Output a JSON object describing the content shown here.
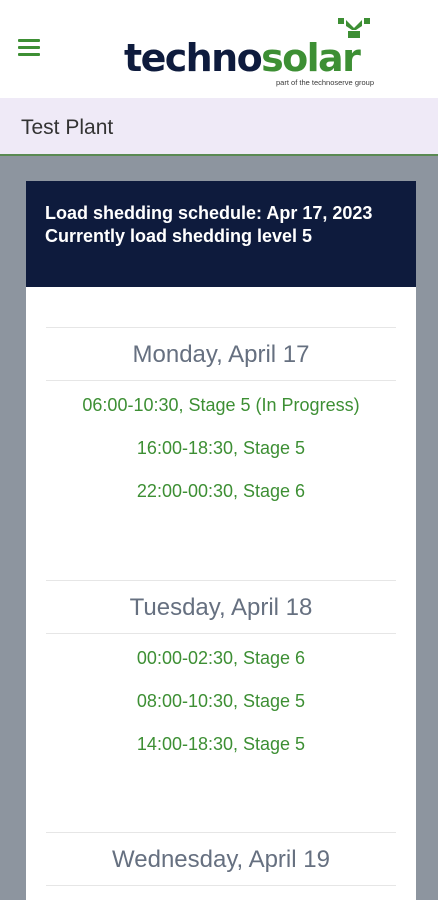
{
  "header": {
    "brand_part1": "techno",
    "brand_part2": "solar",
    "tagline": "part of the technoserve group",
    "menu_icon": "hamburger-menu-icon"
  },
  "plant": {
    "name": "Test Plant"
  },
  "schedule": {
    "heading_line1": "Load shedding schedule: Apr 17, 2023",
    "heading_line2": "Currently load shedding level 5",
    "days": [
      {
        "title": "Monday, April 17",
        "slots": [
          "06:00-10:30, Stage 5 (In Progress)",
          "16:00-18:30, Stage 5",
          "22:00-00:30, Stage 6"
        ]
      },
      {
        "title": "Tuesday, April 18",
        "slots": [
          "00:00-02:30, Stage 6",
          "08:00-10:30, Stage 5",
          "14:00-18:30, Stage 5"
        ]
      },
      {
        "title": "Wednesday, April 19",
        "slots": []
      }
    ]
  },
  "colors": {
    "brand_navy": "#0e1b3d",
    "brand_green": "#3d8f34",
    "background_gray": "#8d959f",
    "plant_bar": "#efeaf7"
  }
}
